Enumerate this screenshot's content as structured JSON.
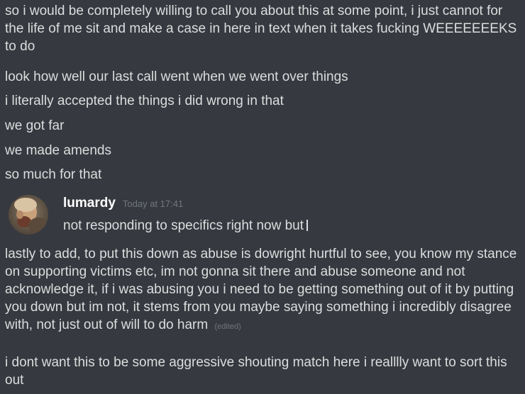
{
  "messages_top": [
    "so i would be completely willing to call you about this at some point, i just cannot for the life of me sit and make a case in here in text when it takes fucking WEEEEEEEKS to do",
    "look how well our last call went when we went over things",
    "i literally accepted the things i did wrong in that",
    "we got far",
    "we made amends",
    "so much for that"
  ],
  "group": {
    "username": "lumardy",
    "timestamp": "Today at 17:41",
    "first_message": "not responding to specifics right now but",
    "messages": [
      "lastly to add, to put this down as abuse is dowright hurtful to see, you know my stance on supporting victims etc, im not gonna sit there and abuse someone and not acknowledge it, if i was abusing you i need to be getting something out of it by putting you down but im not, it stems from you maybe saying something i incredibly disagree with, not just out of will to do harm",
      "i dont want this to be some aggressive shouting match here i realllly want to sort this out"
    ],
    "edited_label": "(edited)"
  },
  "colors": {
    "background": "#36393f",
    "text": "#dcddde",
    "muted": "#72767d",
    "username": "#ffffff"
  }
}
